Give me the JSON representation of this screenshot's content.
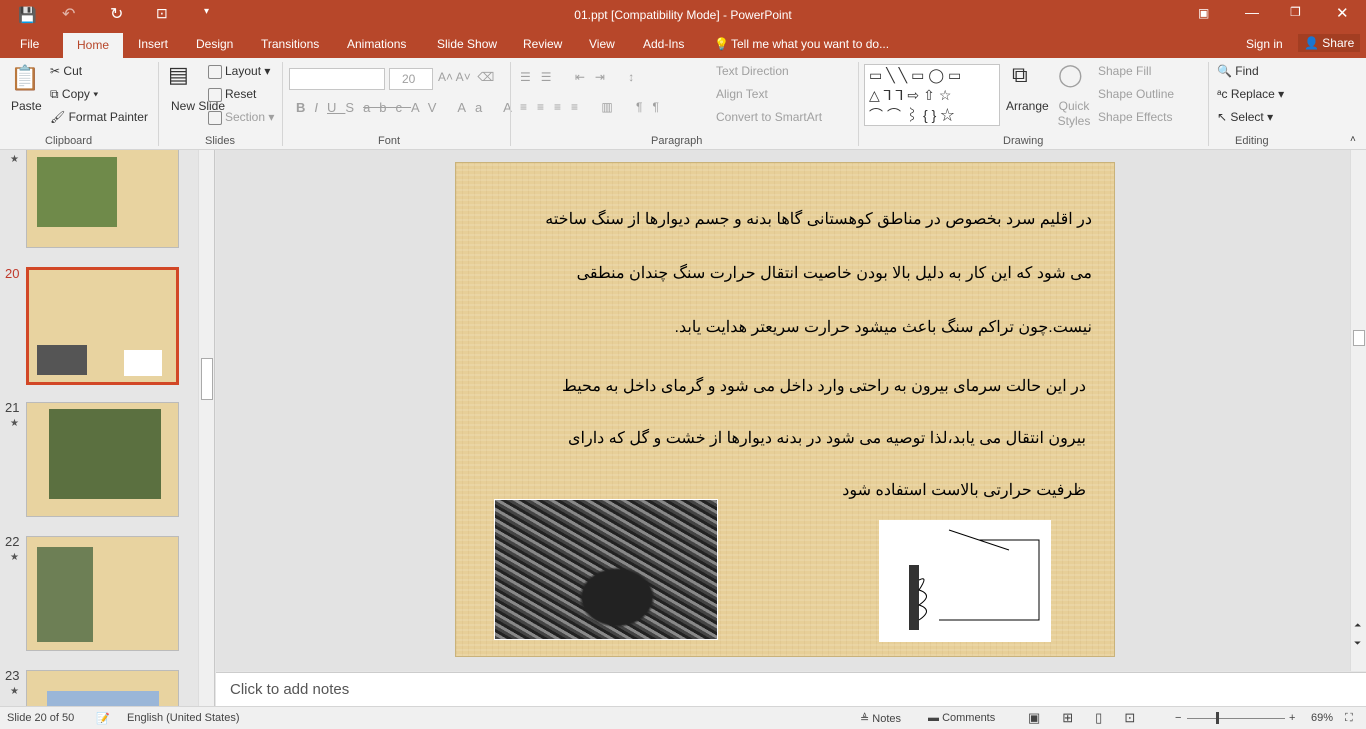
{
  "window": {
    "title": "01.ppt [Compatibility Mode] - PowerPoint",
    "accent": "#b7472a"
  },
  "tabs": [
    "File",
    "Home",
    "Insert",
    "Design",
    "Transitions",
    "Animations",
    "Slide Show",
    "Review",
    "View",
    "Add-Ins"
  ],
  "tell_me": "Tell me what you want to do...",
  "sign_in": "Sign in",
  "share": "Share",
  "ribbon": {
    "clipboard": {
      "label": "Clipboard",
      "paste": "Paste",
      "cut": "Cut",
      "copy": "Copy",
      "format_painter": "Format Painter"
    },
    "slides": {
      "label": "Slides",
      "new_slide": "New Slide",
      "layout": "Layout",
      "reset": "Reset",
      "section": "Section"
    },
    "font": {
      "label": "Font",
      "font_name": "",
      "font_size": "20"
    },
    "paragraph": {
      "label": "Paragraph",
      "text_direction": "Text Direction",
      "align_text": "Align Text",
      "smartart": "Convert to SmartArt"
    },
    "drawing": {
      "label": "Drawing",
      "arrange": "Arrange",
      "quick_styles": "Quick Styles",
      "shape_fill": "Shape Fill",
      "shape_outline": "Shape Outline",
      "shape_effects": "Shape Effects"
    },
    "editing": {
      "label": "Editing",
      "find": "Find",
      "replace": "Replace",
      "select": "Select"
    }
  },
  "thumbnails": [
    {
      "num": "",
      "star": true
    },
    {
      "num": "20",
      "selected": true
    },
    {
      "num": "21",
      "star": true
    },
    {
      "num": "22",
      "star": true
    },
    {
      "num": "23",
      "star": true
    }
  ],
  "slide": {
    "lines": [
      "در اقلیم سرد بخصوص در مناطق کوهستانی گاها بدنه و جسم دیوارها از سنگ ساخته",
      "می شود که این کار به دلیل بالا بودن خاصیت انتقال حرارت سنگ چندان منطقی",
      "نیست.چون تراکم سنگ باعث میشود حرارت سریعتر  هدایت یابد.",
      "در این حالت سرمای بیرون به راحتی وارد داخل می شود و گرمای داخل به محیط",
      "بیرون انتقال می یابد،لذا توصیه می شود در بدنه دیوارها از خشت و گل که دارای",
      "ظرفیت حرارتی بالاست استفاده شود"
    ]
  },
  "notes_placeholder": "Click to add notes",
  "status": {
    "slide": "Slide 20 of 50",
    "language": "English (United States)",
    "notes": "Notes",
    "comments": "Comments",
    "zoom": "69%",
    "zoom_level": 69
  }
}
